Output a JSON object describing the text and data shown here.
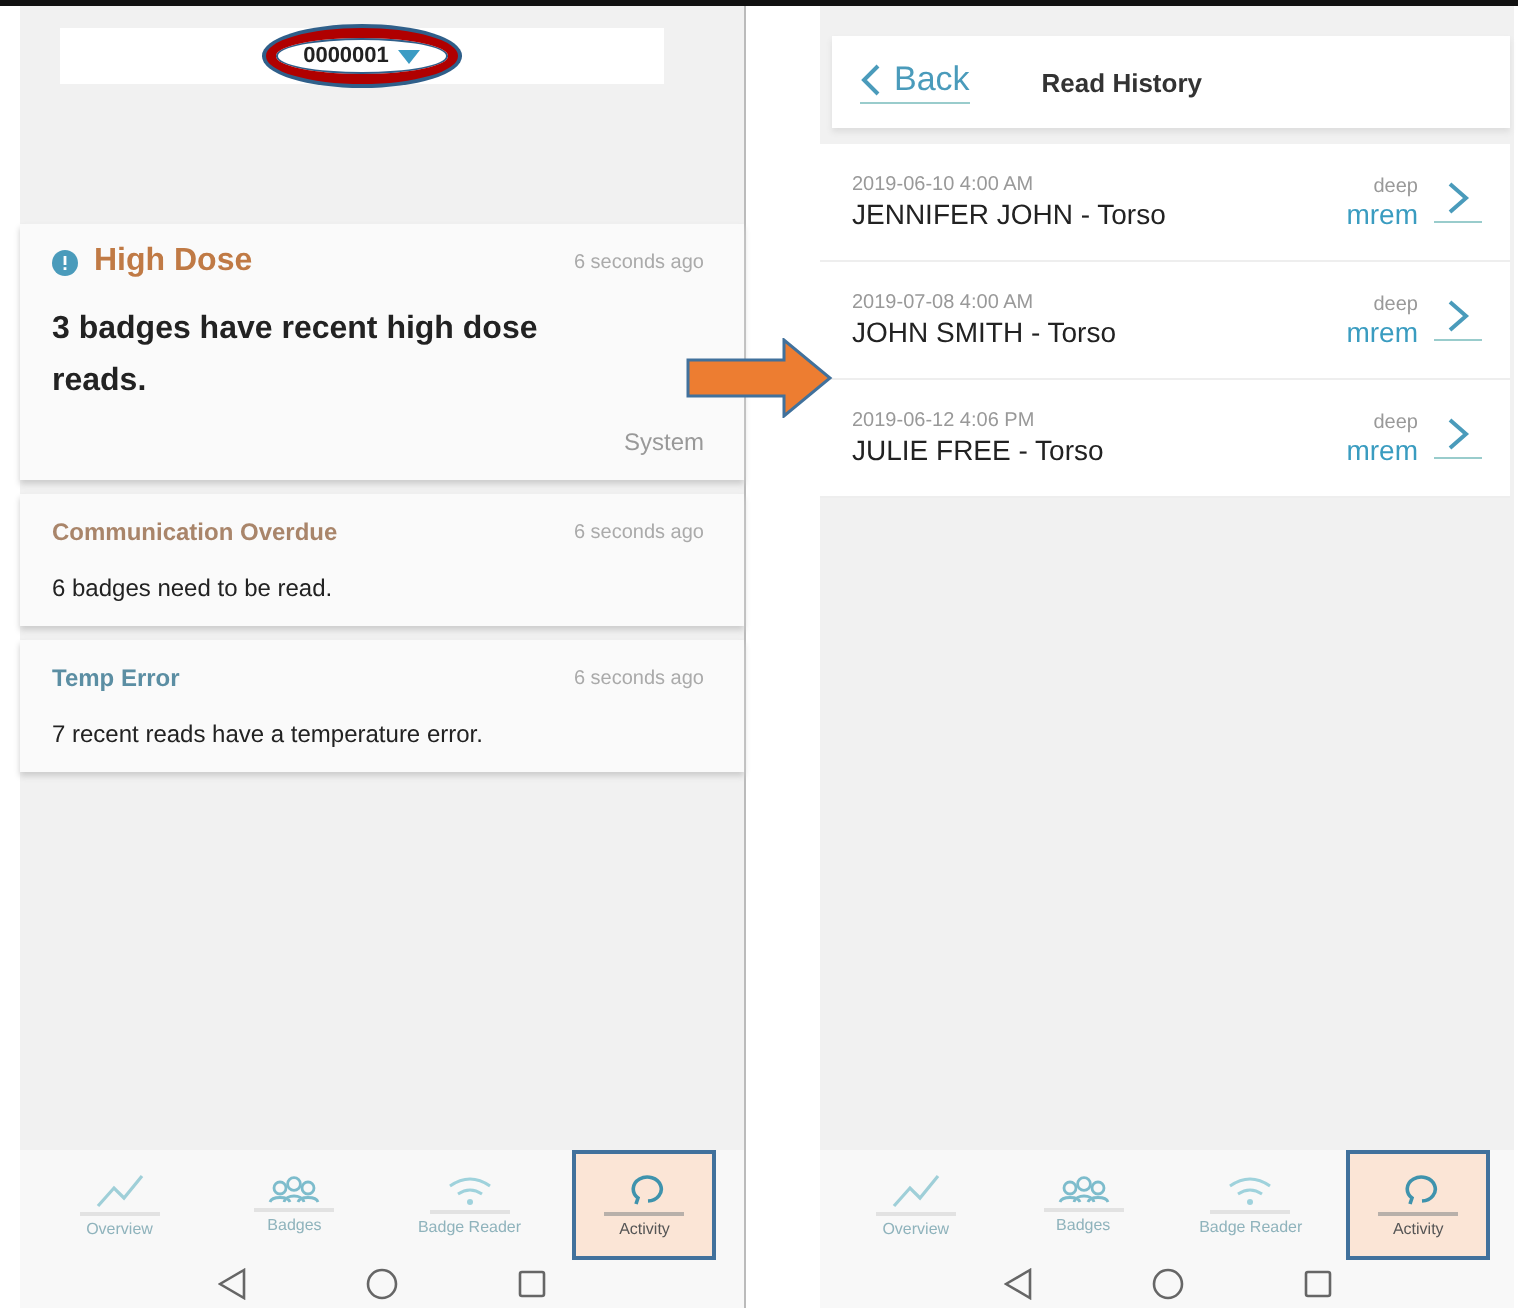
{
  "left_screen": {
    "device_selector": {
      "value": "0000001"
    },
    "alerts": [
      {
        "kind": "major",
        "title": "High Dose",
        "color": "#c07a45",
        "time": "6 seconds ago",
        "message": "3  badges have  recent high dose reads.",
        "source": "System"
      },
      {
        "kind": "minor",
        "title": "Communication Overdue",
        "color": "#a9856a",
        "time": "6 seconds ago",
        "message": "6 badges need to be read."
      },
      {
        "kind": "minor",
        "title": "Temp Error",
        "color": "#5b8ea3",
        "time": "6 seconds ago",
        "message": "7 recent reads have a temperature error."
      }
    ],
    "nav": [
      {
        "label": "Overview",
        "selected": false
      },
      {
        "label": "Badges",
        "selected": false
      },
      {
        "label": "Badge Reader",
        "selected": false
      },
      {
        "label": "Activity",
        "selected": true
      }
    ]
  },
  "right_screen": {
    "back": "Back",
    "title": "Read History",
    "reads": [
      {
        "time": "2019-06-10 4:00 AM",
        "name": "JENNIFER JOHN - Torso",
        "type": "deep",
        "unit": "mrem"
      },
      {
        "time": "2019-07-08 4:00 AM",
        "name": "JOHN SMITH - Torso",
        "type": "deep",
        "unit": "mrem"
      },
      {
        "time": "2019-06-12 4:06 PM",
        "name": "JULIE FREE - Torso",
        "type": "deep",
        "unit": "mrem"
      }
    ],
    "nav": [
      {
        "label": "Overview",
        "selected": false
      },
      {
        "label": "Badges",
        "selected": false
      },
      {
        "label": "Badge Reader",
        "selected": false
      },
      {
        "label": "Activity",
        "selected": true
      }
    ]
  }
}
